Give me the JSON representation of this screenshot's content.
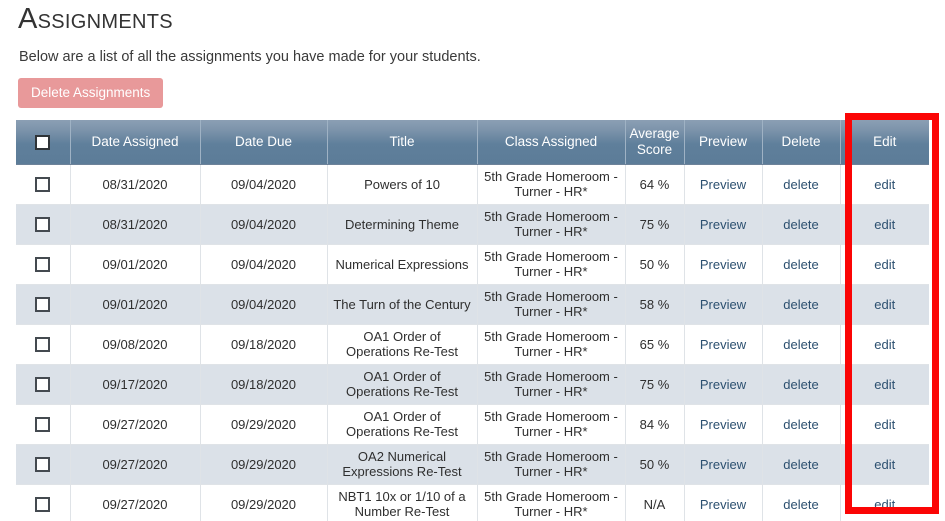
{
  "page": {
    "title": "Assignments",
    "subtitle": "Below are a list of all the assignments you have made for your students.",
    "delete_button_label": "Delete Assignments",
    "accent_button_color": "#e8999a",
    "header_color": "#5f7f9b",
    "link_color": "#2c5070",
    "annotation_color": "#fb0505"
  },
  "table": {
    "columns": [
      {
        "key": "select",
        "label": ""
      },
      {
        "key": "date_assigned",
        "label": "Date Assigned"
      },
      {
        "key": "date_due",
        "label": "Date Due"
      },
      {
        "key": "title",
        "label": "Title"
      },
      {
        "key": "class_assigned",
        "label": "Class Assigned"
      },
      {
        "key": "average_score",
        "label": "Average Score"
      },
      {
        "key": "preview",
        "label": "Preview"
      },
      {
        "key": "delete",
        "label": "Delete"
      },
      {
        "key": "edit",
        "label": "Edit"
      }
    ],
    "row_action_labels": {
      "preview": "Preview",
      "delete": "delete",
      "edit": "edit"
    },
    "rows": [
      {
        "date_assigned": "08/31/2020",
        "date_due": "09/04/2020",
        "title": "Powers of 10",
        "class_assigned": "5th Grade Homeroom - Turner - HR*",
        "average_score": "64 %",
        "preview": "Preview",
        "delete": "delete",
        "edit": "edit"
      },
      {
        "date_assigned": "08/31/2020",
        "date_due": "09/04/2020",
        "title": "Determining Theme",
        "class_assigned": "5th Grade Homeroom - Turner - HR*",
        "average_score": "75 %",
        "preview": "Preview",
        "delete": "delete",
        "edit": "edit"
      },
      {
        "date_assigned": "09/01/2020",
        "date_due": "09/04/2020",
        "title": "Numerical Expressions",
        "class_assigned": "5th Grade Homeroom - Turner - HR*",
        "average_score": "50 %",
        "preview": "Preview",
        "delete": "delete",
        "edit": "edit"
      },
      {
        "date_assigned": "09/01/2020",
        "date_due": "09/04/2020",
        "title": "The Turn of the Century",
        "class_assigned": "5th Grade Homeroom - Turner - HR*",
        "average_score": "58 %",
        "preview": "Preview",
        "delete": "delete",
        "edit": "edit"
      },
      {
        "date_assigned": "09/08/2020",
        "date_due": "09/18/2020",
        "title": "OA1 Order of Operations Re-Test",
        "class_assigned": "5th Grade Homeroom - Turner - HR*",
        "average_score": "65 %",
        "preview": "Preview",
        "delete": "delete",
        "edit": "edit"
      },
      {
        "date_assigned": "09/17/2020",
        "date_due": "09/18/2020",
        "title": "OA1 Order of Operations Re-Test",
        "class_assigned": "5th Grade Homeroom - Turner - HR*",
        "average_score": "75 %",
        "preview": "Preview",
        "delete": "delete",
        "edit": "edit"
      },
      {
        "date_assigned": "09/27/2020",
        "date_due": "09/29/2020",
        "title": "OA1 Order of Operations Re-Test",
        "class_assigned": "5th Grade Homeroom - Turner - HR*",
        "average_score": "84 %",
        "preview": "Preview",
        "delete": "delete",
        "edit": "edit"
      },
      {
        "date_assigned": "09/27/2020",
        "date_due": "09/29/2020",
        "title": "OA2 Numerical Expressions Re-Test",
        "class_assigned": "5th Grade Homeroom - Turner - HR*",
        "average_score": "50 %",
        "preview": "Preview",
        "delete": "delete",
        "edit": "edit"
      },
      {
        "date_assigned": "09/27/2020",
        "date_due": "09/29/2020",
        "title": "NBT1 10x or 1/10 of a Number Re-Test",
        "class_assigned": "5th Grade Homeroom - Turner - HR*",
        "average_score": "N/A",
        "preview": "Preview",
        "delete": "delete",
        "edit": "edit"
      }
    ]
  }
}
